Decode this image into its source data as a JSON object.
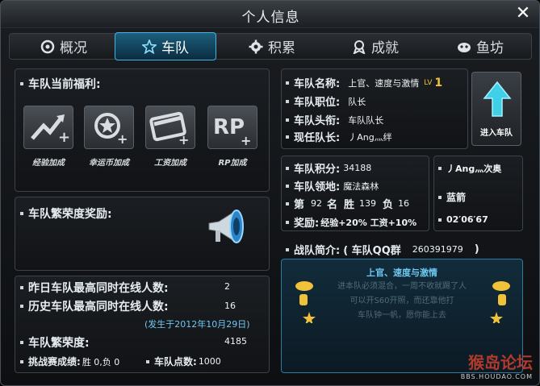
{
  "window": {
    "title": "个人信息"
  },
  "tabs": [
    {
      "label": "概况",
      "icon": "overview-icon"
    },
    {
      "label": "车队",
      "icon": "star-icon"
    },
    {
      "label": "积累",
      "icon": "gear-icon"
    },
    {
      "label": "成就",
      "icon": "medal-icon"
    },
    {
      "label": "鱼坊",
      "icon": "fish-icon"
    }
  ],
  "welfare": {
    "heading": "车队当前福利:",
    "items": [
      {
        "label": "经验加成",
        "icon": "exp-up-icon"
      },
      {
        "label": "幸运币加成",
        "icon": "coin-plus-icon"
      },
      {
        "label": "工资加成",
        "icon": "card-plus-icon"
      },
      {
        "label": "RP加成",
        "icon": "rp-plus-icon"
      }
    ]
  },
  "prosperity_reward": {
    "heading": "车队繁荣度奖励:"
  },
  "stats": {
    "yesterday_online_label": "昨日车队最高同时在线人数:",
    "yesterday_online_value": "2",
    "history_online_label": "历史车队最高同时在线人数:",
    "history_online_value": "16",
    "history_date": "(发生于2012年10月29日)",
    "prosperity_label": "车队繁荣度:",
    "prosperity_value": "4185",
    "challenge_label": "挑战赛成绩:",
    "challenge_value": "胜 0,负 0",
    "points_label": "车队点数:",
    "points_value": "1000"
  },
  "team_info": {
    "name_label": "车队名称:",
    "name_value": "上官、速度与激情",
    "level_prefix": "LV",
    "level_value": "1",
    "position_label": "车队职位:",
    "position_value": "队长",
    "title_label": "车队头衔:",
    "title_value": "车队队长",
    "leader_label": "现任队长:",
    "leader_value": "丿Ang灬绊",
    "enter_label": "进入车队"
  },
  "ranking": {
    "score_label": "车队积分:",
    "score_value": "34188",
    "territory_label": "车队领地:",
    "territory_value": "魔法森林",
    "rank_prefix": "第",
    "rank_value": "92",
    "rank_suffix": "名",
    "win_label": "胜",
    "win_value": "139",
    "loss_label": "负",
    "loss_value": "16",
    "reward_label": "奖励:",
    "reward_value": "经验+20% 工资+10%"
  },
  "side_info": {
    "name": "丿Ang灬次奥",
    "team_color": "蓝箭",
    "time": "02′06′67"
  },
  "intro": {
    "label": "战队简介:",
    "qq_text": "( 车队QQ群",
    "qq_number": "260391979",
    "close_paren": ")",
    "title": "上官、速度与激情",
    "lines": [
      "进本队必须混合，一周不收就踢了人",
      "可以开S60开照，而还靠他打",
      "车队钟一帆，愿你能上去"
    ]
  },
  "watermark": {
    "logo": "猴岛论坛",
    "url": "BBS.HOUDAO.COM"
  },
  "colors": {
    "accent": "#47b3de",
    "highlight": "#6ec8f2",
    "level": "#f0c23a"
  }
}
